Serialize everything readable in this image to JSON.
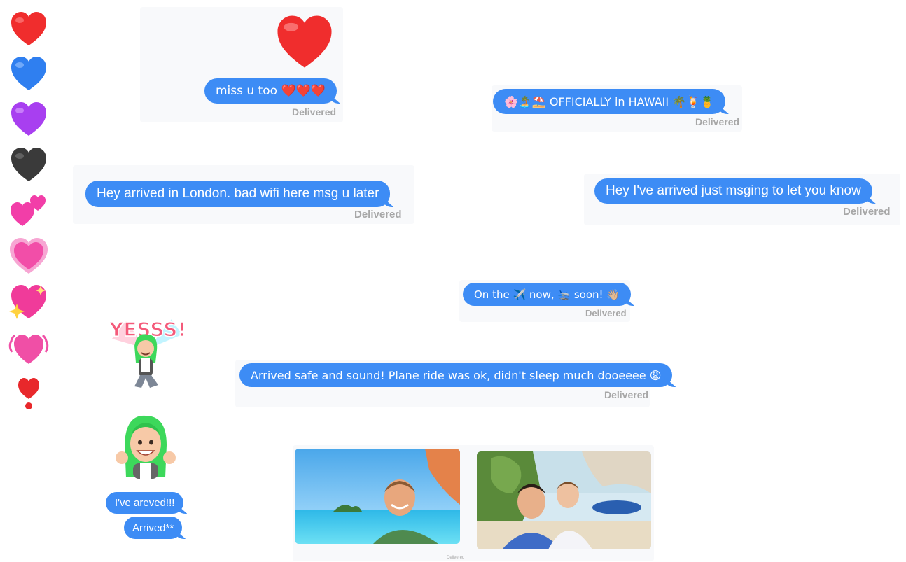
{
  "hearts": [
    {
      "name": "red-heart-icon",
      "color": "#f02d2d"
    },
    {
      "name": "blue-heart-icon",
      "color": "#2f7ff0"
    },
    {
      "name": "purple-heart-icon",
      "color": "#a83ff0"
    },
    {
      "name": "black-heart-icon",
      "color": "#3a3a3a"
    },
    {
      "name": "two-hearts-icon",
      "color": "#f23ea8"
    },
    {
      "name": "growing-heart-icon",
      "color": "#f24ea8"
    },
    {
      "name": "sparkling-heart-icon",
      "color": "#f03b9a"
    },
    {
      "name": "beating-heart-icon",
      "color": "#f04fa6"
    },
    {
      "name": "heart-exclamation-icon",
      "color": "#e8282b"
    }
  ],
  "messages": {
    "miss_u": {
      "text": "miss u too ❤️❤️❤️",
      "status": "Delivered"
    },
    "hawaii": {
      "text": "🌸🏝️⛱️ OFFICIALLY in HAWAII 🌴🍹🍍",
      "status": "Delivered"
    },
    "london": {
      "text": "Hey arrived in London. bad wifi here msg u later",
      "status": "Delivered"
    },
    "arrived": {
      "text": "Hey I've arrived just msging to let you know",
      "status": "Delivered"
    },
    "plane": {
      "text": "On the ✈️ now, 🛬 soon! 👋🏼",
      "status": "Delivered"
    },
    "safe": {
      "text": "Arrived safe and sound! Plane ride was ok, didn't sleep much dooeeee 😩",
      "status": "Delivered"
    },
    "areved": {
      "text": "I've areved!!!"
    },
    "arrived_fix": {
      "text": "Arrived**"
    },
    "photo_status": "Delivered"
  },
  "stickers": {
    "yesss": "YESSS!"
  },
  "colors": {
    "bubble": "#3d8cf5",
    "delivered": "#a7a7a7"
  }
}
